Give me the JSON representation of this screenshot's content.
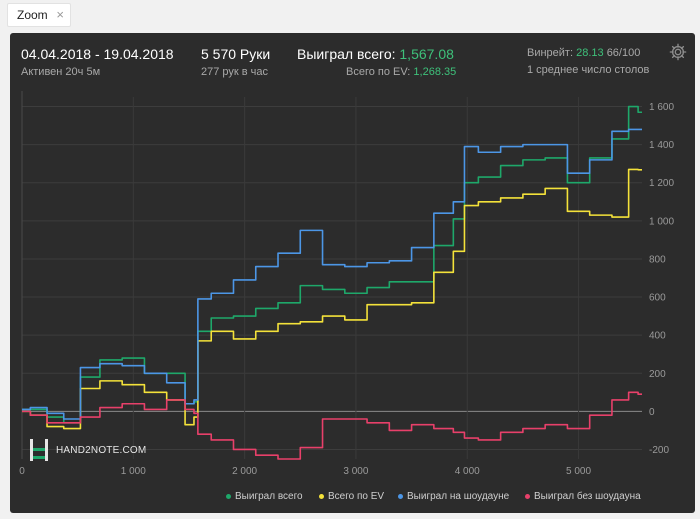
{
  "tab": {
    "label": "Zoom",
    "close": "×"
  },
  "header": {
    "date_range": "04.04.2018 - 19.04.2018",
    "active": "Активен 20ч 5м",
    "hands": "5 570 Руки",
    "hands_per_hour": "277 рук в час",
    "won_total_label": "Выиграл всего:",
    "won_total_value": "1,567.08",
    "ev_label": "Всего по EV:",
    "ev_value": "1,268.35",
    "winrate_label": "Винрейт:",
    "winrate_value": "28.13",
    "winrate_sample": "66/100",
    "avg_tables": "1 среднее число столов"
  },
  "logo": {
    "text": "HAND2NOTE.COM",
    "glyph": "H"
  },
  "icons": {
    "settings": "gear-icon",
    "close": "close-icon"
  },
  "colors": {
    "won_total": "#1ea86a",
    "ev": "#f4e23a",
    "showdown": "#4c96e6",
    "non_showdown": "#e8406a"
  },
  "chart_data": {
    "type": "line",
    "xlabel": "",
    "ylabel": "",
    "xlim": [
      0,
      5570
    ],
    "ylim": [
      -250,
      1650
    ],
    "x_ticks": [
      "0",
      "1 000",
      "2 000",
      "3 000",
      "4 000",
      "5 000"
    ],
    "y_ticks": [
      "-200",
      "0",
      "200",
      "400",
      "600",
      "800",
      "1 000",
      "1 200",
      "1 400",
      "1 600"
    ],
    "legend_position": "bottom",
    "series": [
      {
        "name": "Выиграл всего",
        "x": [
          0,
          150,
          300,
          450,
          600,
          800,
          1000,
          1200,
          1400,
          1530,
          1560,
          1600,
          1800,
          2000,
          2200,
          2400,
          2600,
          2800,
          3000,
          3200,
          3400,
          3600,
          3800,
          3950,
          4000,
          4200,
          4400,
          4600,
          4800,
          5000,
          5200,
          5400,
          5500,
          5570
        ],
        "y": [
          10,
          10,
          -30,
          -60,
          180,
          270,
          280,
          200,
          200,
          40,
          50,
          420,
          490,
          500,
          540,
          570,
          660,
          640,
          620,
          650,
          680,
          680,
          870,
          1010,
          1200,
          1230,
          1290,
          1320,
          1330,
          1200,
          1330,
          1430,
          1600,
          1570
        ]
      },
      {
        "name": "Всего по EV",
        "x": [
          0,
          150,
          300,
          450,
          600,
          800,
          1000,
          1200,
          1400,
          1530,
          1560,
          1600,
          1800,
          2000,
          2200,
          2400,
          2600,
          2800,
          3000,
          3200,
          3400,
          3600,
          3800,
          3950,
          4000,
          4200,
          4400,
          4600,
          4800,
          5000,
          5200,
          5400,
          5500,
          5570
        ],
        "y": [
          0,
          -20,
          -80,
          -90,
          120,
          160,
          140,
          100,
          60,
          -70,
          -30,
          370,
          420,
          380,
          420,
          460,
          470,
          500,
          480,
          560,
          560,
          570,
          730,
          840,
          1080,
          1100,
          1120,
          1140,
          1170,
          1050,
          1030,
          1020,
          1270,
          1268
        ]
      },
      {
        "name": "Выиграл на шоудауне",
        "x": [
          0,
          150,
          300,
          450,
          600,
          800,
          1000,
          1200,
          1400,
          1530,
          1560,
          1600,
          1800,
          2000,
          2200,
          2400,
          2600,
          2800,
          3000,
          3200,
          3400,
          3600,
          3800,
          3950,
          4000,
          4200,
          4400,
          4600,
          4800,
          5000,
          5200,
          5400,
          5500,
          5570
        ],
        "y": [
          10,
          20,
          -10,
          -40,
          230,
          250,
          240,
          200,
          150,
          40,
          60,
          590,
          620,
          690,
          760,
          830,
          950,
          770,
          760,
          780,
          790,
          860,
          1040,
          1100,
          1390,
          1360,
          1390,
          1400,
          1400,
          1250,
          1320,
          1470,
          1480,
          1480
        ]
      },
      {
        "name": "Выиграл без шоудауна",
        "x": [
          0,
          150,
          300,
          450,
          600,
          800,
          1000,
          1200,
          1400,
          1530,
          1560,
          1600,
          1800,
          2000,
          2200,
          2400,
          2600,
          2800,
          3000,
          3200,
          3400,
          3600,
          3800,
          3950,
          4000,
          4200,
          4400,
          4600,
          4800,
          5000,
          5200,
          5400,
          5500,
          5570
        ],
        "y": [
          0,
          -20,
          -60,
          -60,
          -30,
          20,
          40,
          10,
          60,
          10,
          -10,
          -120,
          -150,
          -200,
          -230,
          -250,
          -190,
          -40,
          -40,
          -60,
          -100,
          -70,
          -90,
          -110,
          -140,
          -150,
          -110,
          -90,
          -70,
          -90,
          -20,
          60,
          100,
          90
        ]
      }
    ]
  }
}
